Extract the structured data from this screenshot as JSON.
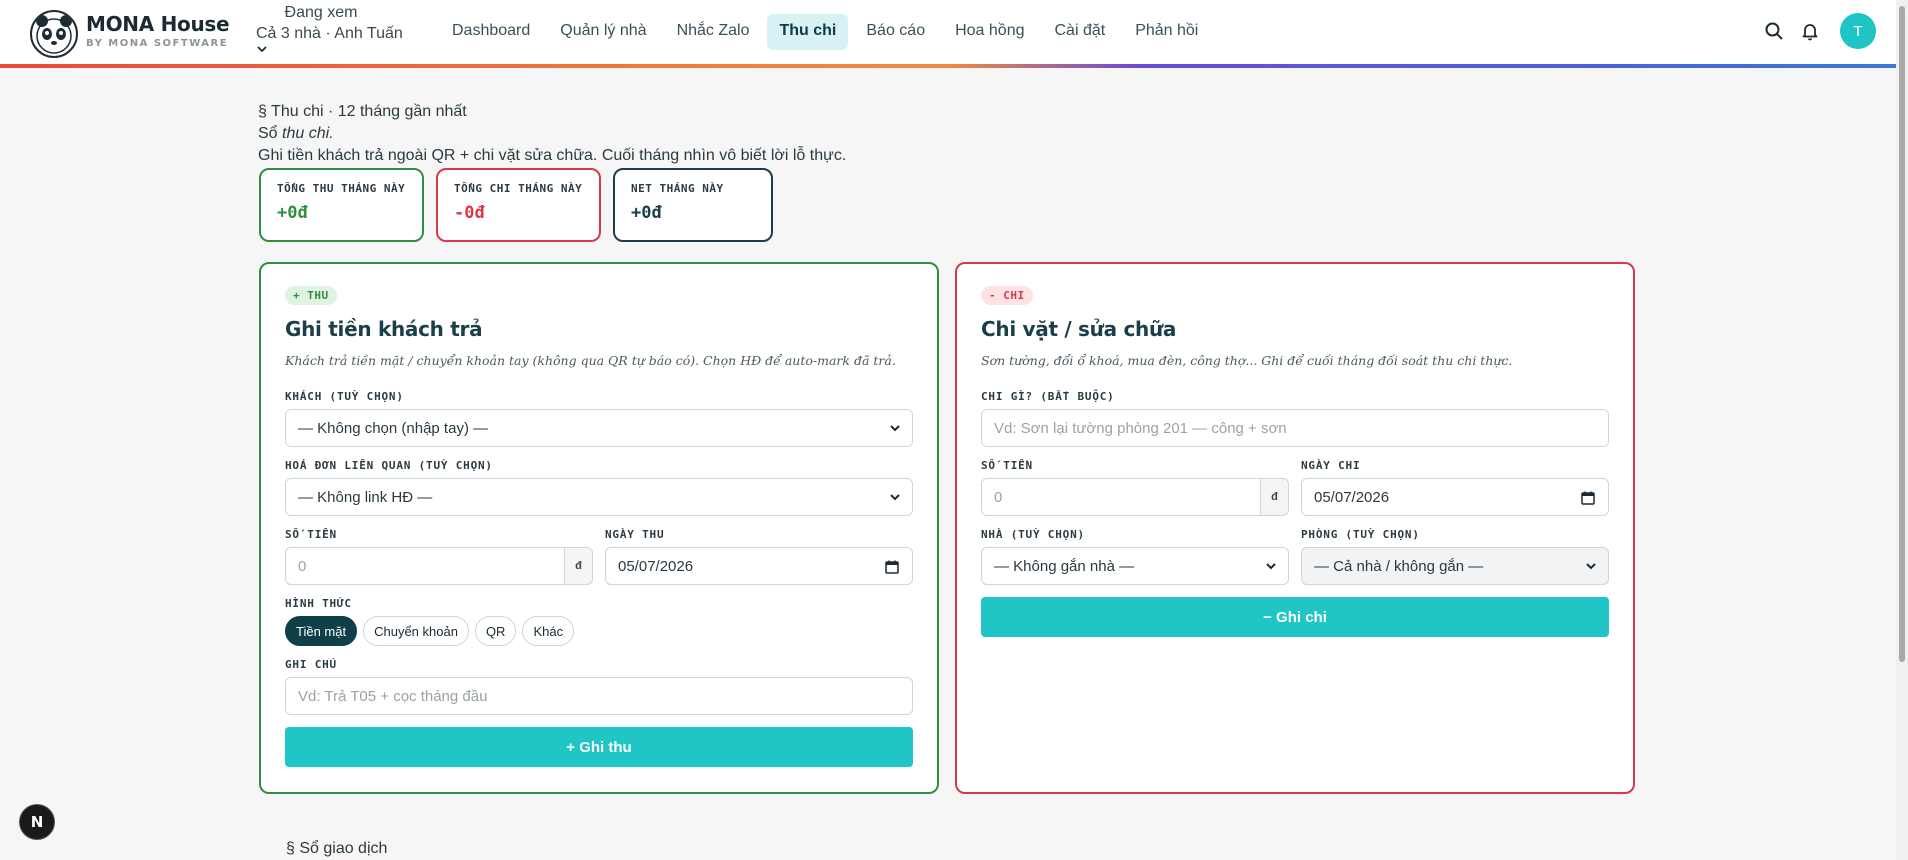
{
  "brand": {
    "name": "MONA House",
    "sub": "BY MONA SOFTWARE"
  },
  "viewing": {
    "label": "Đang xem",
    "value": "Cả 3 nhà · Anh Tuấn"
  },
  "nav": [
    {
      "label": "Dashboard"
    },
    {
      "label": "Quản lý nhà"
    },
    {
      "label": "Nhắc Zalo"
    },
    {
      "label": "Thu chi"
    },
    {
      "label": "Báo cáo"
    },
    {
      "label": "Hoa hồng"
    },
    {
      "label": "Cài đặt"
    },
    {
      "label": "Phản hồi"
    }
  ],
  "active_nav": "Thu chi",
  "user": {
    "initial": "T"
  },
  "header": {
    "kicker": "§ Thu chi · 12 tháng gần nhất",
    "title_prefix": "Sổ ",
    "title_em": "thu chi.",
    "subtitle": "Ghi tiền khách trả ngoài QR + chi vặt sửa chữa. Cuối tháng nhìn vô biết lời lỗ thực."
  },
  "stats": [
    {
      "label": "TỔNG THU THÁNG NÀY",
      "value": "+0đ"
    },
    {
      "label": "TỔNG CHI THÁNG NÀY",
      "value": "-0đ"
    },
    {
      "label": "NET THÁNG NÀY",
      "value": "+0đ"
    }
  ],
  "income": {
    "tag": "+ THU",
    "title": "Ghi tiền khách trả",
    "desc": "Khách trả tiền mặt / chuyển khoản tay (không qua QR tự báo có). Chọn HĐ để auto-mark đã trả.",
    "customer_label": "KHÁCH (TUỲ CHỌN)",
    "customer_value": "— Không chọn (nhập tay) —",
    "invoice_label": "HOÁ ĐƠN LIÊN QUAN (TUỲ CHỌN)",
    "invoice_value": "— Không link HĐ —",
    "amount_label": "SỐ TIỀN",
    "amount_placeholder": "0",
    "currency": "đ",
    "date_label": "NGÀY THU",
    "date_value": "05/07/2026",
    "method_label": "HÌNH THỨC",
    "methods": [
      "Tiền mặt",
      "Chuyển khoản",
      "QR",
      "Khác"
    ],
    "note_label": "GHI CHÚ",
    "note_placeholder": "Vd: Trả T05 + cọc tháng đầu",
    "submit": "+ Ghi thu"
  },
  "expense": {
    "tag": "- CHI",
    "title": "Chi vặt / sửa chữa",
    "desc": "Sơn tường, đổi ổ khoá, mua đèn, công thợ... Ghi để cuối tháng đối soát thu chi thực.",
    "what_label": "CHI GÌ? (BẮT BUỘC)",
    "what_placeholder": "Vd: Sơn lại tường phòng 201 — công + sơn",
    "amount_label": "SỐ TIỀN",
    "amount_placeholder": "0",
    "currency": "đ",
    "date_label": "NGÀY CHI",
    "date_value": "05/07/2026",
    "house_label": "NHÀ (TUỲ CHỌN)",
    "house_value": "— Không gắn nhà —",
    "room_label": "PHÒNG (TUỲ CHỌN)",
    "room_value": "— Cả nhà / không gắn —",
    "submit": "− Ghi chi"
  },
  "ledger": {
    "title": "§ Sổ giao dịch"
  },
  "fab": {
    "label": "N"
  }
}
